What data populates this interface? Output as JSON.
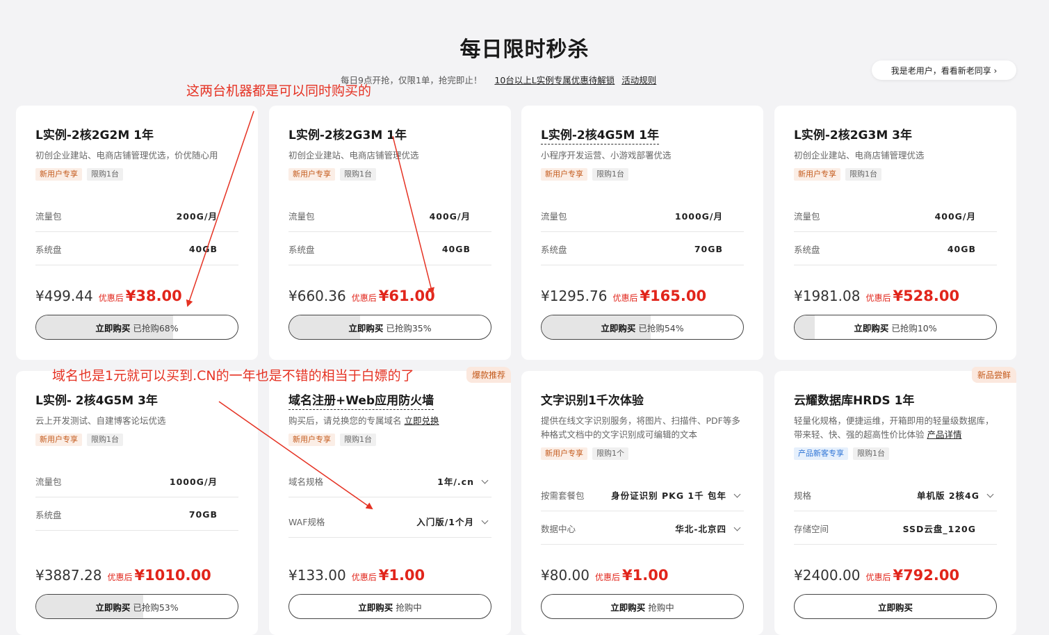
{
  "header": {
    "title": "每日限时秒杀",
    "subtitle": "每日9点开抢，仅限1单，抢完即止！",
    "unlock_link": "10台以上L实例专属优惠待解锁",
    "rules_link": "活动规则",
    "old_user_button": "我是老用户，看看新老同享 ›"
  },
  "annotations": {
    "top": "这两台机器都是可以同时购买的",
    "middle": "域名也是1元就可以买到.CN的一年也是不错的相当于白嫖的了"
  },
  "colors": {
    "accent": "#e1251b",
    "annotation": "#e53223"
  },
  "cards": [
    {
      "title": "L实例-2核2G2M 1年",
      "desc": "初创企业建站、电商店铺管理优选，价优随心用",
      "tags": [
        "新用户专享",
        "限购1台"
      ],
      "specs": [
        {
          "label": "流量包",
          "value": "200G/月"
        },
        {
          "label": "系统盘",
          "value": "40GB"
        }
      ],
      "orig": "¥499.44",
      "after": "优惠后",
      "sale": "¥38.00",
      "buy": "立即购买",
      "sold": "已抢购68%",
      "progress": 0.68
    },
    {
      "title": "L实例-2核2G3M 1年",
      "desc": "初创企业建站、电商店铺管理优选",
      "tags": [
        "新用户专享",
        "限购1台"
      ],
      "specs": [
        {
          "label": "流量包",
          "value": "400G/月"
        },
        {
          "label": "系统盘",
          "value": "40GB"
        }
      ],
      "orig": "¥660.36",
      "after": "优惠后",
      "sale": "¥61.00",
      "buy": "立即购买",
      "sold": "已抢购35%",
      "progress": 0.35
    },
    {
      "title": "L实例-2核4G5M 1年",
      "desc": "小程序开发运营、小游戏部署优选",
      "tags": [
        "新用户专享",
        "限购1台"
      ],
      "specs": [
        {
          "label": "流量包",
          "value": "1000G/月"
        },
        {
          "label": "系统盘",
          "value": "70GB"
        }
      ],
      "orig": "¥1295.76",
      "after": "优惠后",
      "sale": "¥165.00",
      "buy": "立即购买",
      "sold": "已抢购54%",
      "progress": 0.54
    },
    {
      "title": "L实例-2核2G3M 3年",
      "desc": "初创企业建站、电商店铺管理优选",
      "tags": [
        "新用户专享",
        "限购1台"
      ],
      "specs": [
        {
          "label": "流量包",
          "value": "400G/月"
        },
        {
          "label": "系统盘",
          "value": "40GB"
        }
      ],
      "orig": "¥1981.08",
      "after": "优惠后",
      "sale": "¥528.00",
      "buy": "立即购买",
      "sold": "已抢购10%",
      "progress": 0.1
    },
    {
      "title": "L实例- 2核4G5M 3年",
      "desc": "云上开发测试、自建博客论坛优选",
      "tags": [
        "新用户专享",
        "限购1台"
      ],
      "specs": [
        {
          "label": "流量包",
          "value": "1000G/月"
        },
        {
          "label": "系统盘",
          "value": "70GB"
        }
      ],
      "orig": "¥3887.28",
      "after": "优惠后",
      "sale": "¥1010.00",
      "buy": "立即购买",
      "sold": "已抢购53%",
      "progress": 0.53
    },
    {
      "title": "域名注册+Web应用防火墙",
      "desc": "购买后，请兑换您的专属域名",
      "desc_link": "立即兑换",
      "corner": "爆款推荐",
      "tags": [
        "新用户专享",
        "限购1台"
      ],
      "specs": [
        {
          "label": "域名规格",
          "value": "1年/.cn"
        },
        {
          "label": "WAF规格",
          "value": "入门版/1个月"
        }
      ],
      "orig": "¥133.00",
      "after": "优惠后",
      "sale": "¥1.00",
      "buy": "立即购买",
      "sold": "抢购中",
      "progress": 0
    },
    {
      "title": "文字识别1千次体验",
      "desc": "提供在线文字识别服务，将图片、扫描件、PDF等多种格式文档中的文字识别成可编辑的文本",
      "tags": [
        "新用户专享",
        "限购1个"
      ],
      "specs": [
        {
          "label": "按需套餐包",
          "value": "身份证识别 PKG 1千 包年"
        },
        {
          "label": "数据中心",
          "value": "华北-北京四"
        }
      ],
      "orig": "¥80.00",
      "after": "优惠后",
      "sale": "¥1.00",
      "buy": "立即购买",
      "sold": "抢购中",
      "progress": 0
    },
    {
      "title": "云耀数据库HRDS 1年",
      "desc": "轻量化规格，便捷运维，开箱即用的轻量级数据库，带来轻、快、强的超高性价比体验",
      "desc_link": "产品详情",
      "corner": "新品尝鲜",
      "tags": [
        "产品新客专享",
        "限购1台"
      ],
      "specs": [
        {
          "label": "规格",
          "value": "单机版 2核4G"
        },
        {
          "label": "存储空间",
          "value": "SSD云盘_120G"
        }
      ],
      "orig": "¥2400.00",
      "after": "优惠后",
      "sale": "¥792.00",
      "buy": "立即购买",
      "sold": "",
      "progress": 0
    }
  ]
}
